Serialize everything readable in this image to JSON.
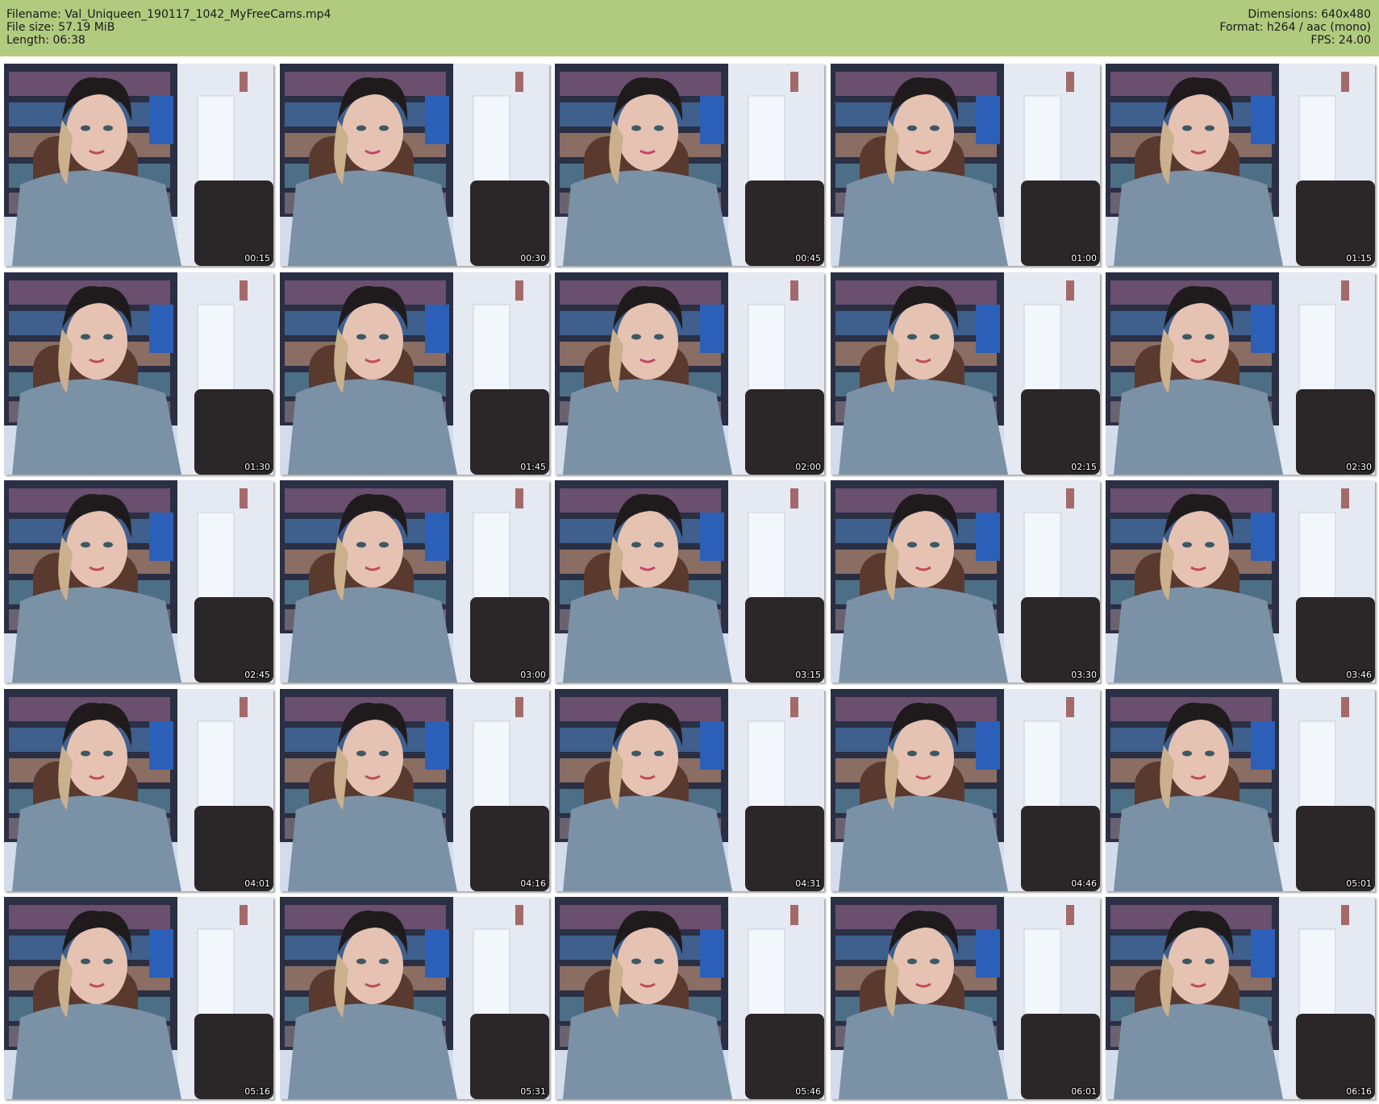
{
  "header": {
    "filename_label": "Filename:",
    "filename": "Val_Uniqueen_190117_1042_MyFreeCams.mp4",
    "filesize_label": "File size:",
    "filesize": "57.19 MiB",
    "length_label": "Length:",
    "length": "06:38",
    "dimensions_label": "Dimensions:",
    "dimensions": "640x480",
    "format_label": "Format:",
    "format": "h264 / aac (mono)",
    "fps_label": "FPS:",
    "fps": "24.00"
  },
  "colors": {
    "header_bg": "#b0ca7e"
  },
  "thumbnails": [
    {
      "time": "00:15"
    },
    {
      "time": "00:30"
    },
    {
      "time": "00:45"
    },
    {
      "time": "01:00"
    },
    {
      "time": "01:15"
    },
    {
      "time": "01:30"
    },
    {
      "time": "01:45"
    },
    {
      "time": "02:00"
    },
    {
      "time": "02:15"
    },
    {
      "time": "02:30"
    },
    {
      "time": "02:45"
    },
    {
      "time": "03:00"
    },
    {
      "time": "03:15"
    },
    {
      "time": "03:30"
    },
    {
      "time": "03:46"
    },
    {
      "time": "04:01"
    },
    {
      "time": "04:16"
    },
    {
      "time": "04:31"
    },
    {
      "time": "04:46"
    },
    {
      "time": "05:01"
    },
    {
      "time": "05:16"
    },
    {
      "time": "05:31"
    },
    {
      "time": "05:46"
    },
    {
      "time": "06:01"
    },
    {
      "time": "06:16"
    }
  ]
}
